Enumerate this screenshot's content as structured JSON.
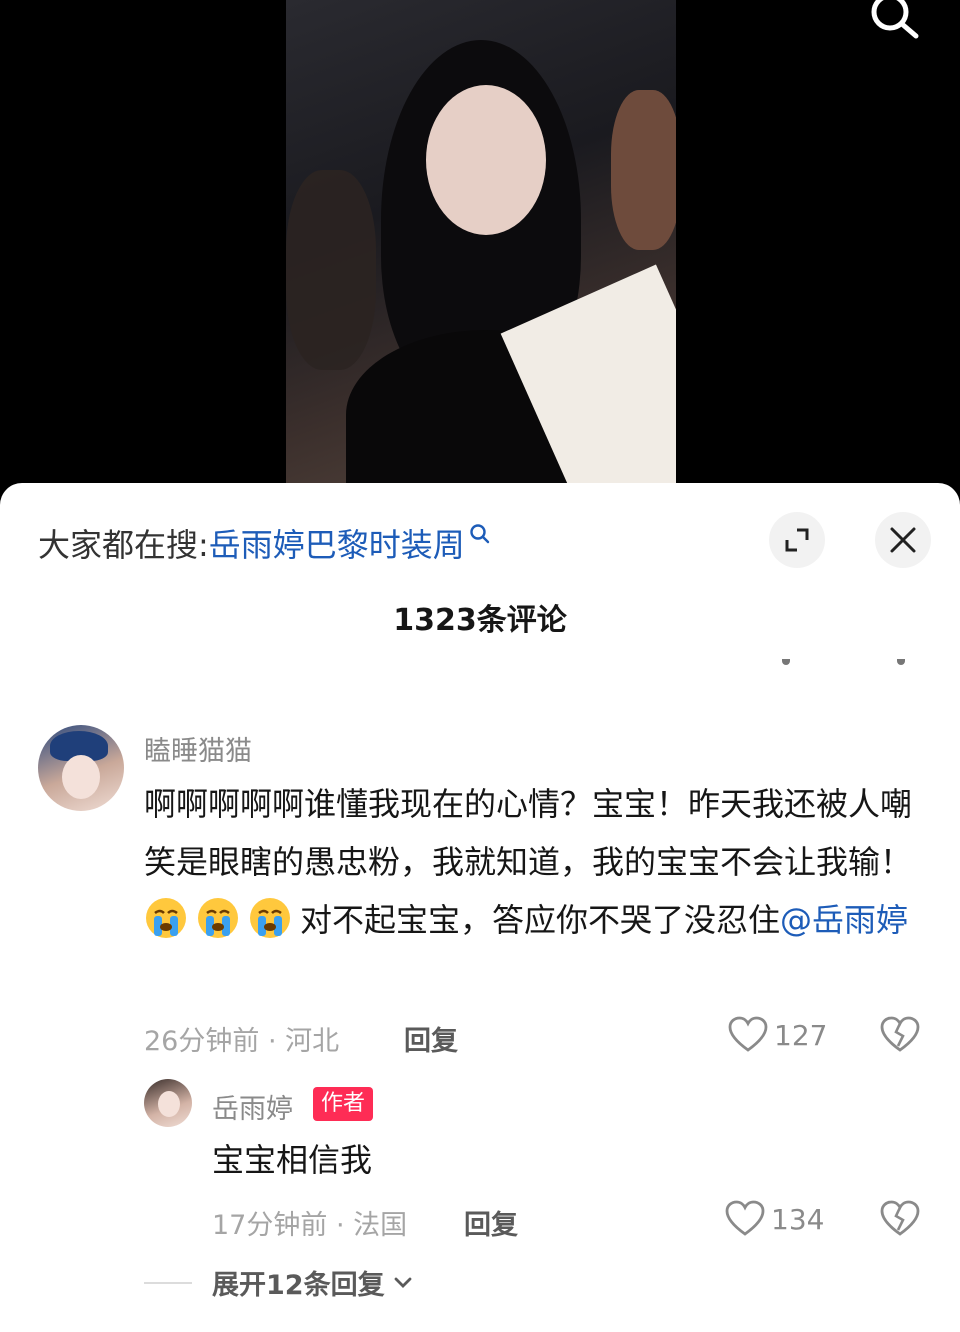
{
  "top_bar": {
    "search_icon": "search-icon"
  },
  "panel": {
    "trending_label": "大家都在搜:",
    "trending_keyword": "岳雨婷巴黎时装周",
    "expand_icon": "expand-icon",
    "close_icon": "close-icon",
    "comment_count": "1323条评论"
  },
  "comment": {
    "username": "瞌睡猫猫",
    "text_part1": "啊啊啊啊啊谁懂我现在的心情？宝宝！昨天我还被人嘲笑是眼瞎的愚忠粉，我就知道，我的宝宝不会让我输！",
    "emojis": [
      "loudly-crying-emoji",
      "loudly-crying-emoji",
      "loudly-crying-emoji"
    ],
    "text_part2": "对不起宝宝，答应你不哭了没忍住",
    "mention": "@岳雨婷",
    "meta": "26分钟前 · 河北",
    "reply_label": "回复",
    "likes": "127"
  },
  "reply": {
    "username": "岳雨婷",
    "badge": "作者",
    "text": "宝宝相信我",
    "meta": "17分钟前 · 法国",
    "reply_label": "回复",
    "likes": "134"
  },
  "expand_replies": "展开12条回复",
  "colors": {
    "accent_link": "#1d5cb8",
    "author_badge": "#fe2c55"
  }
}
